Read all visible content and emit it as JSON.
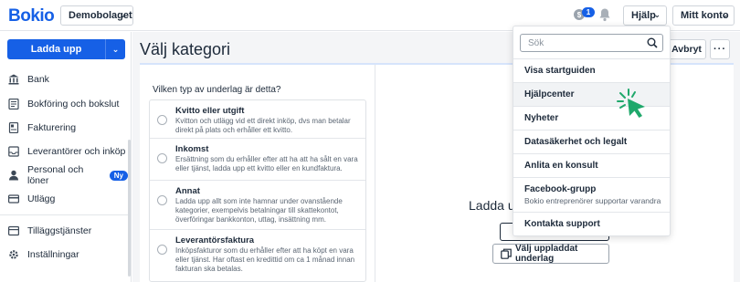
{
  "topbar": {
    "logo": "Bokio",
    "company": "Demobolaget",
    "coin_symbol": "$",
    "notification_count": "1",
    "help_label": "Hjälp",
    "account_label": "Mitt konto"
  },
  "sidebar": {
    "upload_label": "Ladda upp",
    "items": [
      {
        "label": "Bank",
        "icon": "bank-icon"
      },
      {
        "label": "Bokföring och bokslut",
        "icon": "ledger-icon"
      },
      {
        "label": "Fakturering",
        "icon": "invoice-icon"
      },
      {
        "label": "Leverantörer och inköp",
        "icon": "inbox-icon"
      },
      {
        "label": "Personal och löner",
        "icon": "person-icon",
        "badge": "Ny"
      },
      {
        "label": "Utlägg",
        "icon": "card-icon"
      },
      {
        "label": "Tilläggstjänster",
        "icon": "addon-icon"
      },
      {
        "label": "Inställningar",
        "icon": "gear-icon"
      }
    ]
  },
  "main": {
    "title": "Välj kategori",
    "cancel_label": "Avbryt",
    "more_label": "···",
    "question": "Vilken typ av underlag är detta?",
    "options": [
      {
        "title": "Kvitto eller utgift",
        "description": "Kvitton och utlägg vid ett direkt inköp, dvs man betalar direkt på plats och erhåller ett kvitto."
      },
      {
        "title": "Inkomst",
        "description": "Ersättning som du erhåller efter att ha att ha sålt en vara eller tjänst, ladda upp ett kvitto eller en kundfaktura."
      },
      {
        "title": "Annat",
        "description": "Ladda upp allt som inte hamnar under ovanstående kategorier, exempelvis betalningar till skattekontot, överföringar bankkonton, uttag, insättning mm."
      },
      {
        "title": "Leverantörsfaktura",
        "description": "Inköpsfakturor som du erhåller efter att ha köpt en vara eller tjänst. Har oftast en kredittid om ca 1 månad innan fakturan ska betalas."
      }
    ],
    "upload_title": "Ladda up",
    "choose_label": "Välj uppladdat underlag"
  },
  "help_menu": {
    "search_placeholder": "Sök",
    "items": [
      {
        "label": "Visa startguiden"
      },
      {
        "label": "Hjälpcenter"
      },
      {
        "label": "Nyheter"
      },
      {
        "label": "Datasäkerhet och legalt"
      },
      {
        "label": "Anlita en konsult"
      },
      {
        "label": "Facebook-grupp",
        "sub": "Bokio entreprenörer supportar varandra"
      },
      {
        "label": "Kontakta support"
      }
    ]
  },
  "colors": {
    "brand": "#1660e6",
    "cursor": "#1fa86b"
  }
}
